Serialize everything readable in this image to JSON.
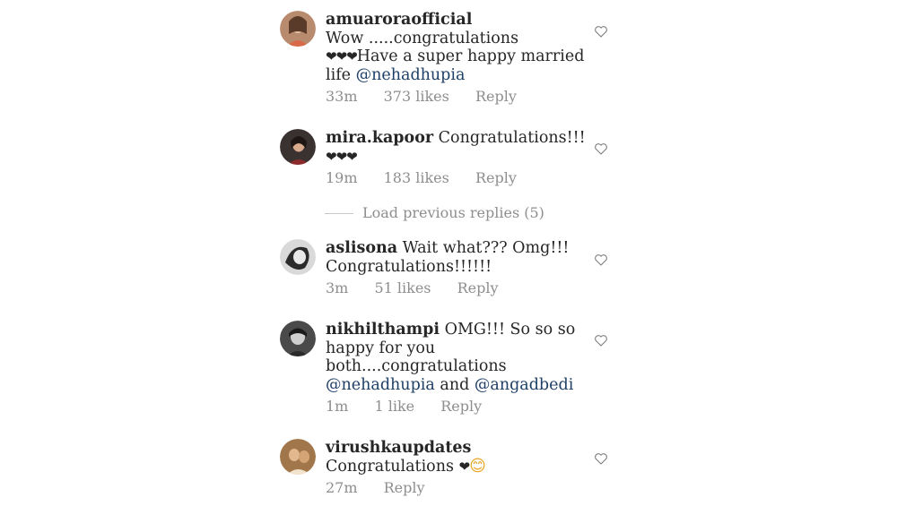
{
  "comments": [
    {
      "username": "amuaroraofficial",
      "text_before": "Wow .....congratulations",
      "hearts": "❤❤❤",
      "text_after": "Have a super happy married life",
      "mention": "@nehadhupia",
      "time": "33m",
      "likes": "373 likes",
      "reply": "Reply"
    },
    {
      "username": "mira.kapoor",
      "text": "Congratulations!!!",
      "hearts": "❤❤❤",
      "time": "19m",
      "likes": "183 likes",
      "reply": "Reply"
    },
    {
      "username": "aslisona",
      "text": "Wait what??? Omg!!! Congratulations!!!!!!",
      "time": "3m",
      "likes": "51 likes",
      "reply": "Reply"
    },
    {
      "username": "nikhilthampi",
      "text": "OMG!!! So so so happy for you both....congratulations",
      "mention1": "@nehadhupia",
      "and": "and",
      "mention2": "@angadbedi",
      "time": "1m",
      "likes": "1 like",
      "reply": "Reply"
    },
    {
      "username": "virushkaupdates",
      "text": "Congratulations",
      "heart": "❤",
      "emoji": "😊",
      "time": "27m",
      "reply": "Reply"
    }
  ],
  "load_previous": "Load previous replies (5)",
  "colors": {
    "mention": "#1e3f66",
    "meta": "#8e8e8e",
    "text": "#262626"
  }
}
